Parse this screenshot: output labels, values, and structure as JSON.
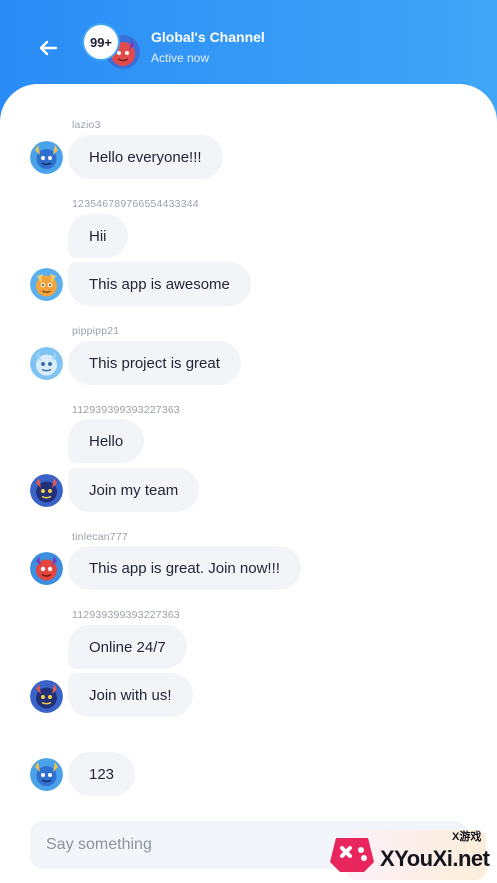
{
  "header": {
    "title": "Global's Channel",
    "status": "Active now",
    "badge": "99+"
  },
  "messages": [
    {
      "username": "lazio3",
      "text": "Hello everyone!!!",
      "avatar": "blue-monster-avatar"
    },
    {
      "username": "123546789766554433344",
      "text": "Hii",
      "avatar": null
    },
    {
      "username": null,
      "text": "This app is awesome",
      "avatar": "orange-monster-avatar"
    },
    {
      "username": "pippipp21",
      "text": "This project is great",
      "avatar": "lightblue-monster-avatar"
    },
    {
      "username": "112939399393227363",
      "text": "Hello",
      "avatar": null
    },
    {
      "username": null,
      "text": "Join my team",
      "avatar": "navy-monster-avatar"
    },
    {
      "username": "tinlecan777",
      "text": "This app is great. Join now!!!",
      "avatar": "red-monster-avatar"
    },
    {
      "username": "112939399393227363",
      "text": "Online 24/7",
      "avatar": null
    },
    {
      "username": null,
      "text": "Join with us!",
      "avatar": "navy-monster-avatar"
    },
    {
      "username": null,
      "text": "123",
      "avatar": "blue-monster-avatar"
    }
  ],
  "composer": {
    "placeholder": "Say something"
  },
  "watermark": {
    "text": "XYouXi.net",
    "chinese": "X游戏"
  },
  "colors": {
    "header_gradient_start": "#2a8cf6",
    "header_gradient_end": "#3fa6f7",
    "bubble_bg": "#f2f4f8",
    "text": "#1f2535",
    "muted": "#9aa0ab"
  }
}
